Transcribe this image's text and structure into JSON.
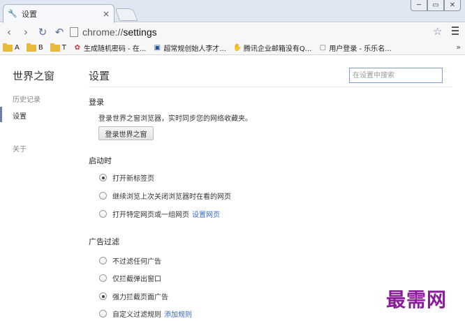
{
  "tab": {
    "icon": "wrench-icon",
    "title": "设置",
    "close": "×"
  },
  "window_controls": [
    "─",
    "▭",
    "✕"
  ],
  "toolbar": {
    "back": "‹",
    "forward": "›",
    "reload": "↻",
    "undo": "↶",
    "url_scheme": "chrome://",
    "url_path": "settings",
    "star": "☆"
  },
  "bookmarks": [
    {
      "type": "folder",
      "label": "A"
    },
    {
      "type": "folder",
      "label": "B"
    },
    {
      "type": "folder",
      "label": "T"
    },
    {
      "type": "link",
      "icon": "✿",
      "label": "生成随机密码 - 在..."
    },
    {
      "type": "link",
      "icon": "▣",
      "label": "超常规创始人李才..."
    },
    {
      "type": "link",
      "icon": "✋",
      "label": "腾讯企业邮箱没有Q..."
    },
    {
      "type": "link",
      "icon": "▢",
      "label": "用户登录 - 乐乐名..."
    }
  ],
  "bookmarks_more": "»",
  "sidebar": {
    "title": "世界之窗",
    "items": [
      {
        "label": "历史记录"
      },
      {
        "label": "设置"
      },
      {
        "label": "关于"
      }
    ]
  },
  "main": {
    "title": "设置",
    "search_placeholder": "在设置中搜索",
    "signin": {
      "heading": "登录",
      "description": "登录世界之窗浏览器，实时同步您的网络收藏夹。",
      "button": "登录世界之窗"
    },
    "startup": {
      "heading": "启动时",
      "options": [
        {
          "label": "打开新标签页",
          "selected": true,
          "link": ""
        },
        {
          "label": "继续浏览上次关闭浏览器时在看的网页",
          "selected": false,
          "link": ""
        },
        {
          "label": "打开特定网页或一组网页",
          "selected": false,
          "link": "设置网页"
        }
      ]
    },
    "adfilter": {
      "heading": "广告过滤",
      "options": [
        {
          "label": "不过滤任何广告",
          "selected": false,
          "link": ""
        },
        {
          "label": "仅拦截弹出窗口",
          "selected": false,
          "link": ""
        },
        {
          "label": "强力拦截页面广告",
          "selected": true,
          "link": ""
        },
        {
          "label": "自定义过滤规则",
          "selected": false,
          "link": "添加规则"
        }
      ]
    }
  },
  "watermark": "最需网"
}
